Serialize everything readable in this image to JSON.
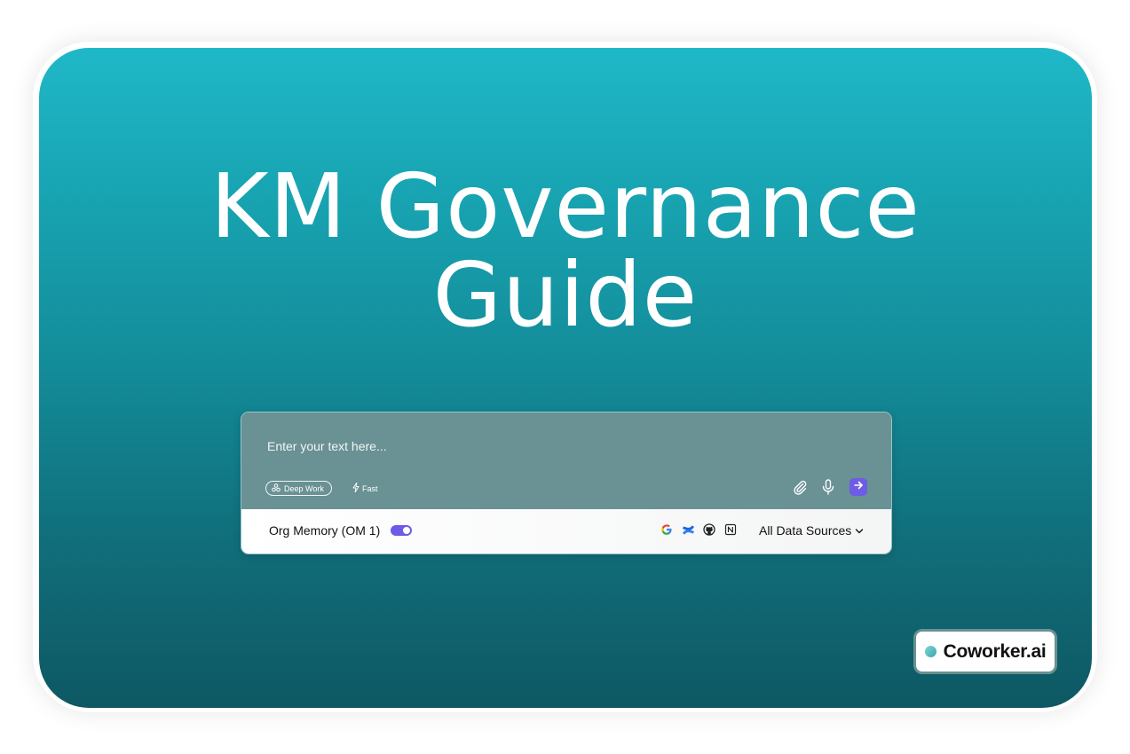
{
  "title": {
    "line1": "KM Governance",
    "line2": "Guide"
  },
  "prompt": {
    "placeholder": "Enter your text here...",
    "value": "",
    "modes": {
      "deep_work": "Deep Work",
      "fast": "Fast"
    },
    "tools": [
      "paperclip-icon",
      "microphone-icon",
      "arrow-right-icon"
    ]
  },
  "memory": {
    "label": "Org Memory (OM 1)",
    "enabled": true
  },
  "sources": {
    "icons": [
      "google-icon",
      "confluence-icon",
      "github-icon",
      "notion-icon"
    ],
    "dropdown_label": "All Data Sources"
  },
  "brand": {
    "name": "Coworker.ai"
  },
  "colors": {
    "card_top": "#1fb8c8",
    "card_bottom": "#0e5863",
    "accent": "#6f5ce6",
    "prompt_bg": "#6a9194"
  }
}
